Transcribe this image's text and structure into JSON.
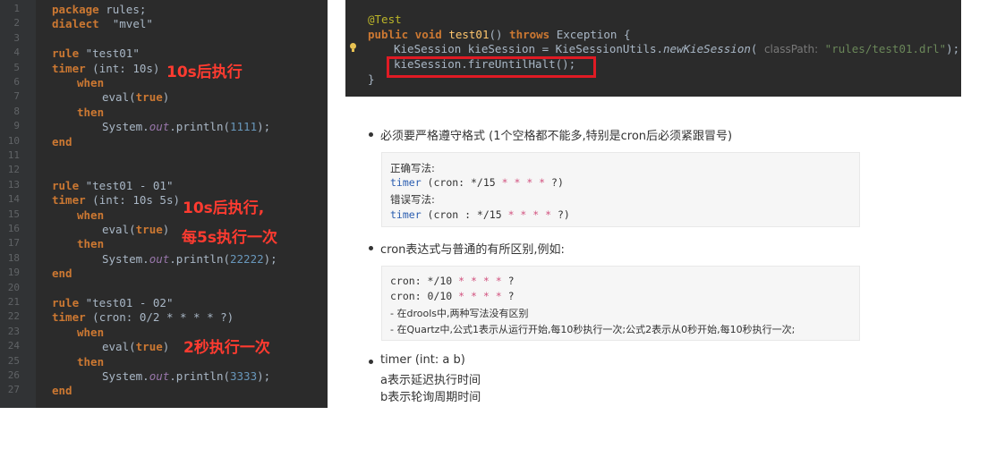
{
  "left_editor": {
    "line_numbers": [
      "1",
      "2",
      "3",
      "4",
      "5",
      "6",
      "7",
      "8",
      "9",
      "10",
      "11",
      "12",
      "13",
      "14",
      "15",
      "16",
      "17",
      "18",
      "19",
      "20",
      "21",
      "22",
      "23",
      "24",
      "25",
      "26",
      "27"
    ],
    "lines": {
      "l1_kw": "package",
      "l1_rest": " rules;",
      "l2_kw": "dialect",
      "l2_rest": "  \"mvel\"",
      "l4_kw": "rule",
      "l4_rest": " \"test01\"",
      "l5_kw": "timer",
      "l5_rest": " (int: 10s)",
      "l6_kw": "when",
      "l7_a": "eval(",
      "l7_kw": "true",
      "l7_b": ")",
      "l8_kw": "then",
      "l9_a": "System.",
      "l9_f": "out",
      "l9_b": ".println(",
      "l9_n": "1111",
      "l9_c": ");",
      "l10_kw": "end",
      "l13_kw": "rule",
      "l13_rest": " \"test01 - 01\"",
      "l14_kw": "timer",
      "l14_rest": " (int: 10s 5s)",
      "l15_kw": "when",
      "l16_a": "eval(",
      "l16_kw": "true",
      "l16_b": ")",
      "l17_kw": "then",
      "l18_a": "System.",
      "l18_f": "out",
      "l18_b": ".println(",
      "l18_n": "22222",
      "l18_c": ");",
      "l19_kw": "end",
      "l21_kw": "rule",
      "l21_rest": " \"test01 - 02\"",
      "l22_kw": "timer",
      "l22_rest": " (cron: 0/2 * * * * ?)",
      "l23_kw": "when",
      "l24_a": "eval(",
      "l24_kw": "true",
      "l24_b": ")",
      "l25_kw": "then",
      "l26_a": "System.",
      "l26_f": "out",
      "l26_b": ".println(",
      "l26_n": "3333",
      "l26_c": ");",
      "l27_kw": "end"
    },
    "notes": {
      "n1": "10s后执行",
      "n2a": "10s后执行,",
      "n2b": "每5s执行一次",
      "n3": "2秒执行一次"
    }
  },
  "right_editor": {
    "annotation": "@Test",
    "sig_kw1": "public void ",
    "sig_fn": "test01",
    "sig_mid": "() ",
    "sig_kw2": "throws",
    "sig_end": " Exception {",
    "l3_a": "KieSession kieSession = KieSessionUtils.",
    "l3_m": "newKieSession",
    "l3_b": "( ",
    "l3_hint": "classPath:",
    "l3_str": " \"rules/test01.drl\"",
    "l3_c": ");",
    "l4": "kieSession.fireUntilHalt();",
    "l5": "}"
  },
  "doc": {
    "b1": "必须要严格遵守格式 (1个空格都不能多,特别是cron后必须紧跟冒号)",
    "box1": {
      "correct_label": "正确写法:",
      "c_kw": "timer",
      "c_mid": " (cron: */15 ",
      "c_stars": "* * * *",
      "c_end": " ?)",
      "wrong_label": "错误写法:",
      "w_kw": "timer",
      "w_mid": " (cron : */15 ",
      "w_stars": "* * * *",
      "w_end": " ?)"
    },
    "b2": "cron表达式与普通的有所区别,例如:",
    "box2": {
      "l1_a": "cron: */10 ",
      "l1_b": "* * * *",
      "l1_c": " ?",
      "l2_a": "cron: 0/10 ",
      "l2_b": "* * * *",
      "l2_c": " ?",
      "l3": "- 在drools中,两种写法没有区别",
      "l4": "- 在Quartz中,公式1表示从运行开始,每10秒执行一次;公式2表示从0秒开始,每10秒执行一次;"
    },
    "b3": "timer (int: a b)",
    "b3_l2": "a表示延迟执行时间",
    "b3_l3": "b表示轮询周期时间"
  }
}
